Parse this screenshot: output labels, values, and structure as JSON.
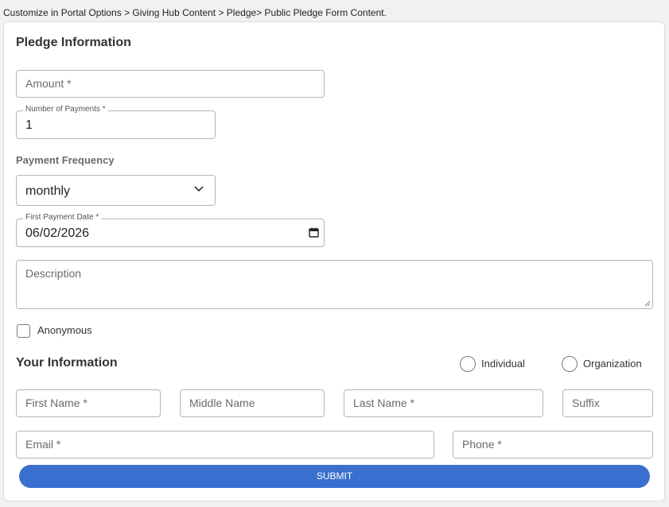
{
  "breadcrumb": "Customize in Portal Options > Giving Hub Content > Pledge> Public Pledge Form Content.",
  "pledge": {
    "title": "Pledge Information",
    "amount_placeholder": "Amount *",
    "num_payments_label": "Number of Payments *",
    "num_payments_value": "1",
    "frequency_label": "Payment Frequency",
    "frequency_value": "monthly",
    "first_date_label": "First Payment Date *",
    "first_date_value": "06/02/2026",
    "description_placeholder": "Description",
    "anonymous_label": "Anonymous"
  },
  "your_info": {
    "title": "Your Information",
    "individual_label": "Individual",
    "organization_label": "Organization",
    "first_name": "First Name *",
    "middle_name": "Middle Name",
    "last_name": "Last Name *",
    "suffix": "Suffix",
    "email": "Email *",
    "phone": "Phone *"
  },
  "submit_label": "SUBMIT",
  "colors": {
    "submit_bg": "#3a6fcf",
    "border": "#b5b5b5"
  },
  "icons": {
    "frequency_dropdown": "chevron-down-icon",
    "date_picker": "calendar-icon"
  }
}
